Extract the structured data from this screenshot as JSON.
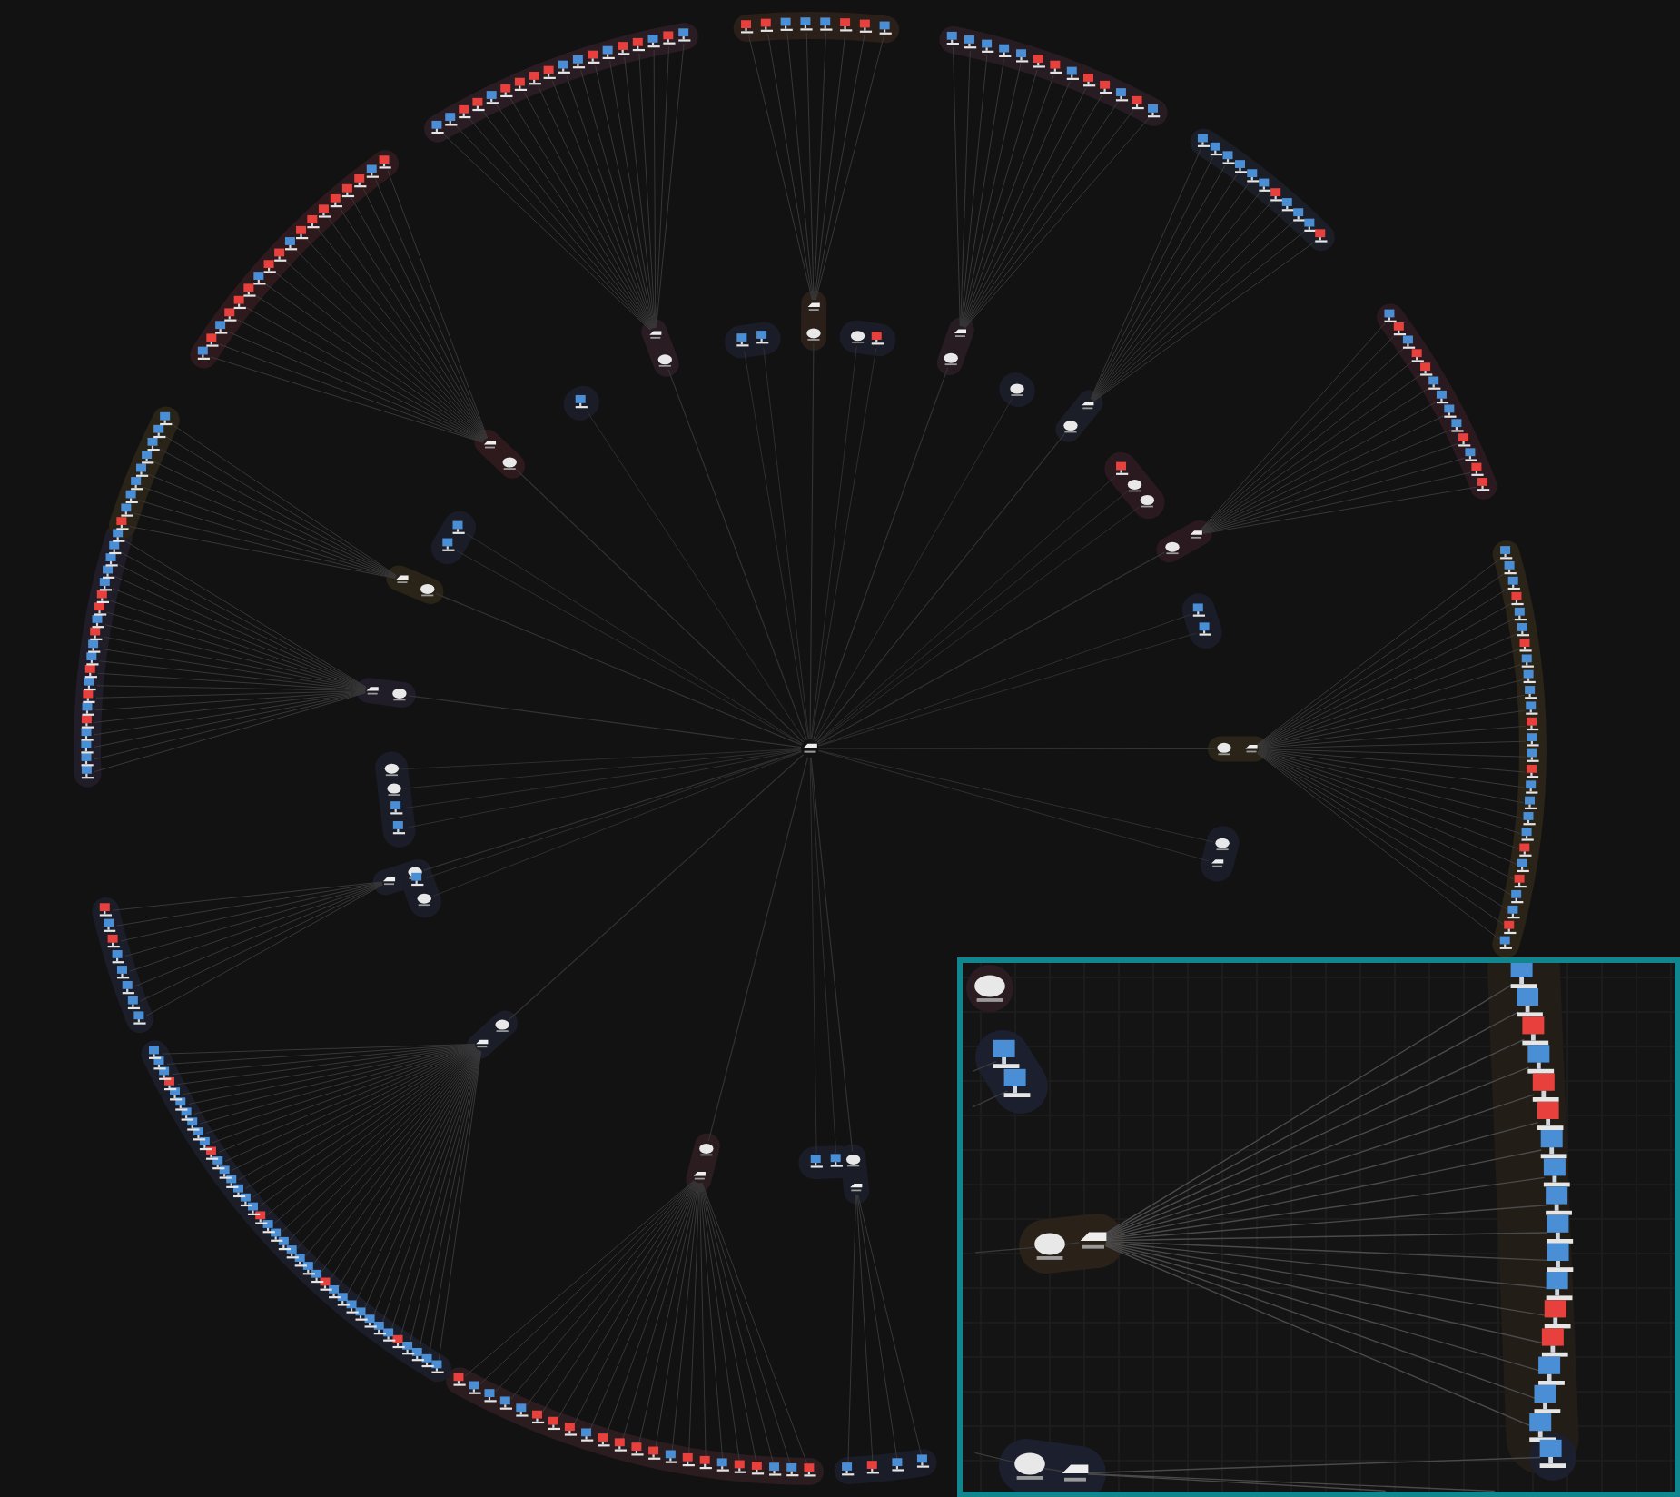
{
  "graph": {
    "hub": {
      "kind": "router"
    },
    "clusters": [
      {
        "color": "#2b1f1a",
        "computers": [
          {
            "color": "#e8403c"
          },
          {
            "color": "#e8403c"
          },
          {
            "color": "#4a8fd6"
          },
          {
            "color": "#4a8fd6"
          },
          {
            "color": "#4a8fd6"
          },
          {
            "color": "#e8403c"
          },
          {
            "color": "#e8403c"
          },
          {
            "color": "#4a8fd6"
          }
        ]
      },
      {
        "color": "#261c22",
        "computers": [
          {
            "color": "#4a8fd6"
          },
          {
            "color": "#4a8fd6"
          },
          {
            "color": "#4a8fd6"
          },
          {
            "color": "#4a8fd6"
          },
          {
            "color": "#4a8fd6"
          },
          {
            "color": "#e8403c"
          },
          {
            "color": "#e8403c"
          },
          {
            "color": "#4a8fd6"
          },
          {
            "color": "#e8403c"
          },
          {
            "color": "#e8403c"
          },
          {
            "color": "#4a8fd6"
          },
          {
            "color": "#e8403c"
          },
          {
            "color": "#4a8fd6"
          }
        ]
      },
      {
        "color": "#1c1e27",
        "computers": [
          {
            "color": "#4a8fd6"
          },
          {
            "color": "#4a8fd6"
          },
          {
            "color": "#4a8fd6"
          },
          {
            "color": "#4a8fd6"
          },
          {
            "color": "#4a8fd6"
          },
          {
            "color": "#4a8fd6"
          },
          {
            "color": "#e8403c"
          },
          {
            "color": "#4a8fd6"
          },
          {
            "color": "#4a8fd6"
          },
          {
            "color": "#4a8fd6"
          },
          {
            "color": "#e8403c"
          }
        ]
      },
      {
        "color": "#2a1a20",
        "computers": [
          {
            "color": "#4a8fd6"
          },
          {
            "color": "#e8403c"
          },
          {
            "color": "#4a8fd6"
          },
          {
            "color": "#e8403c"
          },
          {
            "color": "#e8403c"
          },
          {
            "color": "#4a8fd6"
          },
          {
            "color": "#4a8fd6"
          },
          {
            "color": "#4a8fd6"
          },
          {
            "color": "#4a8fd6"
          },
          {
            "color": "#e8403c"
          },
          {
            "color": "#4a8fd6"
          },
          {
            "color": "#e8403c"
          },
          {
            "color": "#e8403c"
          }
        ]
      },
      {
        "color": "#2a2318",
        "computers": [
          {
            "color": "#4a8fd6"
          },
          {
            "color": "#4a8fd6"
          },
          {
            "color": "#4a8fd6"
          },
          {
            "color": "#e8403c"
          },
          {
            "color": "#4a8fd6"
          },
          {
            "color": "#4a8fd6"
          },
          {
            "color": "#e8403c"
          },
          {
            "color": "#4a8fd6"
          },
          {
            "color": "#4a8fd6"
          },
          {
            "color": "#4a8fd6"
          },
          {
            "color": "#4a8fd6"
          },
          {
            "color": "#e8403c"
          },
          {
            "color": "#4a8fd6"
          },
          {
            "color": "#4a8fd6"
          },
          {
            "color": "#e8403c"
          },
          {
            "color": "#4a8fd6"
          },
          {
            "color": "#4a8fd6"
          },
          {
            "color": "#4a8fd6"
          },
          {
            "color": "#4a8fd6"
          },
          {
            "color": "#e8403c"
          },
          {
            "color": "#4a8fd6"
          },
          {
            "color": "#e8403c"
          },
          {
            "color": "#4a8fd6"
          },
          {
            "color": "#4a8fd6"
          },
          {
            "color": "#e8403c"
          },
          {
            "color": "#4a8fd6"
          }
        ]
      },
      {
        "color": "#1a1d28",
        "computers": [
          {
            "color": "#4a8fd6"
          },
          {
            "color": "#4a8fd6"
          },
          {
            "color": "#e8403c"
          },
          {
            "color": "#4a8fd6"
          }
        ]
      },
      {
        "color": "#2a1c1f",
        "computers": [
          {
            "color": "#e8403c"
          },
          {
            "color": "#4a8fd6"
          },
          {
            "color": "#4a8fd6"
          },
          {
            "color": "#e8403c"
          },
          {
            "color": "#e8403c"
          },
          {
            "color": "#4a8fd6"
          },
          {
            "color": "#e8403c"
          },
          {
            "color": "#e8403c"
          },
          {
            "color": "#4a8fd6"
          },
          {
            "color": "#e8403c"
          },
          {
            "color": "#e8403c"
          },
          {
            "color": "#e8403c"
          },
          {
            "color": "#e8403c"
          },
          {
            "color": "#4a8fd6"
          },
          {
            "color": "#e8403c"
          },
          {
            "color": "#e8403c"
          },
          {
            "color": "#e8403c"
          },
          {
            "color": "#4a8fd6"
          },
          {
            "color": "#4a8fd6"
          },
          {
            "color": "#4a8fd6"
          },
          {
            "color": "#4a8fd6"
          },
          {
            "color": "#e8403c"
          }
        ]
      },
      {
        "color": "#1b1e29",
        "computers": [
          {
            "color": "#4a8fd6"
          },
          {
            "color": "#4a8fd6"
          },
          {
            "color": "#4a8fd6"
          },
          {
            "color": "#4a8fd6"
          },
          {
            "color": "#e8403c"
          },
          {
            "color": "#4a8fd6"
          },
          {
            "color": "#4a8fd6"
          },
          {
            "color": "#4a8fd6"
          },
          {
            "color": "#4a8fd6"
          },
          {
            "color": "#4a8fd6"
          },
          {
            "color": "#4a8fd6"
          },
          {
            "color": "#4a8fd6"
          },
          {
            "color": "#e8403c"
          },
          {
            "color": "#4a8fd6"
          },
          {
            "color": "#4a8fd6"
          },
          {
            "color": "#4a8fd6"
          },
          {
            "color": "#4a8fd6"
          },
          {
            "color": "#4a8fd6"
          },
          {
            "color": "#4a8fd6"
          },
          {
            "color": "#4a8fd6"
          },
          {
            "color": "#e8403c"
          },
          {
            "color": "#4a8fd6"
          },
          {
            "color": "#4a8fd6"
          },
          {
            "color": "#4a8fd6"
          },
          {
            "color": "#4a8fd6"
          },
          {
            "color": "#4a8fd6"
          },
          {
            "color": "#4a8fd6"
          },
          {
            "color": "#e8403c"
          },
          {
            "color": "#4a8fd6"
          },
          {
            "color": "#4a8fd6"
          },
          {
            "color": "#4a8fd6"
          },
          {
            "color": "#4a8fd6"
          },
          {
            "color": "#4a8fd6"
          },
          {
            "color": "#4a8fd6"
          },
          {
            "color": "#e8403c"
          },
          {
            "color": "#4a8fd6"
          },
          {
            "color": "#4a8fd6"
          },
          {
            "color": "#4a8fd6"
          }
        ]
      },
      {
        "color": "#1b1e29",
        "computers": [
          {
            "color": "#4a8fd6"
          },
          {
            "color": "#4a8fd6"
          },
          {
            "color": "#4a8fd6"
          },
          {
            "color": "#4a8fd6"
          },
          {
            "color": "#4a8fd6"
          },
          {
            "color": "#e8403c"
          },
          {
            "color": "#4a8fd6"
          },
          {
            "color": "#e8403c"
          }
        ]
      },
      {
        "color": "#201c28",
        "computers": [
          {
            "color": "#4a8fd6"
          },
          {
            "color": "#4a8fd6"
          },
          {
            "color": "#4a8fd6"
          },
          {
            "color": "#4a8fd6"
          },
          {
            "color": "#e8403c"
          },
          {
            "color": "#4a8fd6"
          },
          {
            "color": "#e8403c"
          },
          {
            "color": "#4a8fd6"
          },
          {
            "color": "#e8403c"
          },
          {
            "color": "#4a8fd6"
          },
          {
            "color": "#4a8fd6"
          },
          {
            "color": "#e8403c"
          },
          {
            "color": "#4a8fd6"
          },
          {
            "color": "#e8403c"
          },
          {
            "color": "#e8403c"
          },
          {
            "color": "#4a8fd6"
          },
          {
            "color": "#4a8fd6"
          },
          {
            "color": "#4a8fd6"
          },
          {
            "color": "#4a8fd6"
          },
          {
            "color": "#4a8fd6"
          }
        ]
      },
      {
        "color": "#2a2418",
        "computers": [
          {
            "color": "#e8403c"
          },
          {
            "color": "#4a8fd6"
          },
          {
            "color": "#4a8fd6"
          },
          {
            "color": "#4a8fd6"
          },
          {
            "color": "#4a8fd6"
          },
          {
            "color": "#4a8fd6"
          },
          {
            "color": "#4a8fd6"
          },
          {
            "color": "#4a8fd6"
          },
          {
            "color": "#4a8fd6"
          }
        ]
      },
      {
        "color": "#2e1a1c",
        "computers": [
          {
            "color": "#4a8fd6"
          },
          {
            "color": "#e8403c"
          },
          {
            "color": "#4a8fd6"
          },
          {
            "color": "#e8403c"
          },
          {
            "color": "#e8403c"
          },
          {
            "color": "#e8403c"
          },
          {
            "color": "#4a8fd6"
          },
          {
            "color": "#e8403c"
          },
          {
            "color": "#e8403c"
          },
          {
            "color": "#4a8fd6"
          },
          {
            "color": "#e8403c"
          },
          {
            "color": "#e8403c"
          },
          {
            "color": "#e8403c"
          },
          {
            "color": "#e8403c"
          },
          {
            "color": "#e8403c"
          },
          {
            "color": "#e8403c"
          },
          {
            "color": "#4a8fd6"
          },
          {
            "color": "#e8403c"
          }
        ]
      },
      {
        "color": "#291c22",
        "computers": [
          {
            "color": "#4a8fd6"
          },
          {
            "color": "#4a8fd6"
          },
          {
            "color": "#e8403c"
          },
          {
            "color": "#e8403c"
          },
          {
            "color": "#4a8fd6"
          },
          {
            "color": "#e8403c"
          },
          {
            "color": "#e8403c"
          },
          {
            "color": "#e8403c"
          },
          {
            "color": "#e8403c"
          },
          {
            "color": "#4a8fd6"
          },
          {
            "color": "#4a8fd6"
          },
          {
            "color": "#e8403c"
          },
          {
            "color": "#4a8fd6"
          },
          {
            "color": "#e8403c"
          },
          {
            "color": "#e8403c"
          },
          {
            "color": "#4a8fd6"
          },
          {
            "color": "#e8403c"
          },
          {
            "color": "#4a8fd6"
          }
        ]
      }
    ],
    "standalone": [
      {
        "color": "#1a1d28",
        "devices": [
          {
            "kind": "computer",
            "color": "#4a8fd6"
          },
          {
            "kind": "computer",
            "color": "#4a8fd6"
          }
        ]
      },
      {
        "color": "#1a1d28",
        "devices": [
          {
            "kind": "server"
          },
          {
            "kind": "computer",
            "color": "#e8403c"
          }
        ]
      },
      {
        "color": "#1a1d28",
        "devices": [
          {
            "kind": "computer",
            "color": "#4a8fd6"
          }
        ]
      },
      {
        "color": "#1a1d28",
        "devices": [
          {
            "kind": "computer",
            "color": "#4a8fd6"
          },
          {
            "kind": "computer",
            "color": "#4a8fd6"
          }
        ]
      },
      {
        "color": "#1a1d28",
        "devices": [
          {
            "kind": "computer",
            "color": "#4a8fd6"
          },
          {
            "kind": "computer",
            "color": "#4a8fd6"
          },
          {
            "kind": "server"
          },
          {
            "kind": "server"
          }
        ]
      },
      {
        "color": "#1a1d28",
        "devices": [
          {
            "kind": "server"
          },
          {
            "kind": "computer",
            "color": "#4a8fd6"
          }
        ]
      },
      {
        "color": "#1a1d28",
        "devices": [
          {
            "kind": "server"
          }
        ]
      },
      {
        "color": "#2a1a20",
        "devices": [
          {
            "kind": "computer",
            "color": "#e8403c"
          },
          {
            "kind": "server"
          },
          {
            "kind": "server"
          }
        ]
      },
      {
        "color": "#1a1d28",
        "devices": [
          {
            "kind": "computer",
            "color": "#4a8fd6"
          },
          {
            "kind": "computer",
            "color": "#4a8fd6"
          }
        ]
      },
      {
        "color": "#1a1d28",
        "devices": [
          {
            "kind": "server"
          },
          {
            "kind": "router"
          }
        ]
      },
      {
        "color": "#1a1d28",
        "devices": [
          {
            "kind": "computer",
            "color": "#4a8fd6"
          },
          {
            "kind": "computer",
            "color": "#4a8fd6"
          }
        ]
      }
    ]
  },
  "inset": {
    "groups": [
      {
        "color": "#2a1c20",
        "devices": [
          {
            "kind": "server"
          }
        ]
      },
      {
        "color": "#1c1f2e",
        "devices": [
          {
            "kind": "computer",
            "color": "#4a8fd6"
          },
          {
            "kind": "computer",
            "color": "#4a8fd6"
          }
        ]
      },
      {
        "color": "#2a2119",
        "devices": [
          {
            "kind": "server"
          },
          {
            "kind": "router"
          }
        ]
      },
      {
        "color": "#221d16",
        "devices": [
          {
            "kind": "computer",
            "color": "#4a8fd6"
          },
          {
            "kind": "computer",
            "color": "#4a8fd6"
          },
          {
            "kind": "computer",
            "color": "#e8403c"
          },
          {
            "kind": "computer",
            "color": "#4a8fd6"
          },
          {
            "kind": "computer",
            "color": "#e8403c"
          },
          {
            "kind": "computer",
            "color": "#e8403c"
          },
          {
            "kind": "computer",
            "color": "#4a8fd6"
          },
          {
            "kind": "computer",
            "color": "#4a8fd6"
          },
          {
            "kind": "computer",
            "color": "#4a8fd6"
          },
          {
            "kind": "computer",
            "color": "#4a8fd6"
          },
          {
            "kind": "computer",
            "color": "#4a8fd6"
          },
          {
            "kind": "computer",
            "color": "#4a8fd6"
          },
          {
            "kind": "computer",
            "color": "#e8403c"
          },
          {
            "kind": "computer",
            "color": "#e8403c"
          },
          {
            "kind": "computer",
            "color": "#4a8fd6"
          },
          {
            "kind": "computer",
            "color": "#4a8fd6"
          },
          {
            "kind": "computer",
            "color": "#4a8fd6"
          }
        ]
      },
      {
        "color": "#1c1f2e",
        "devices": [
          {
            "kind": "server"
          },
          {
            "kind": "router"
          }
        ]
      },
      {
        "color": "#1c1f2e",
        "devices": [
          {
            "kind": "computer",
            "color": "#4a8fd6"
          }
        ]
      }
    ]
  }
}
